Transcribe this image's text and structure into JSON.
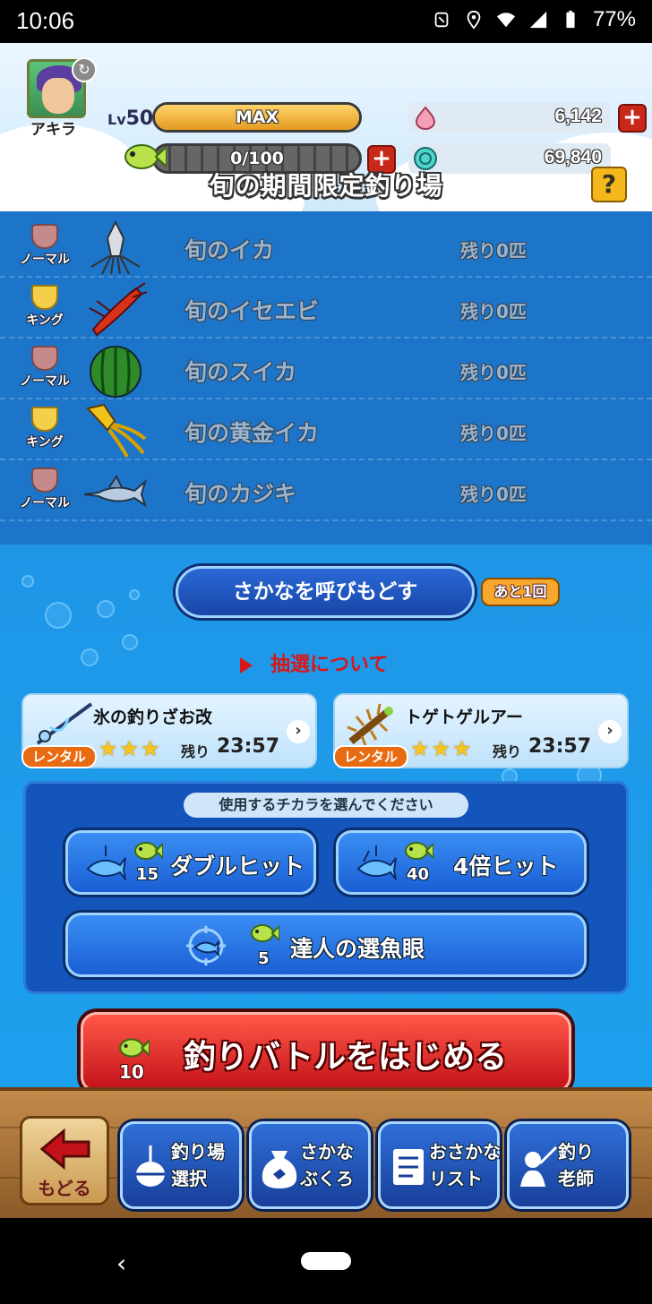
{
  "status_bar": {
    "time": "10:06",
    "battery": "77%"
  },
  "header": {
    "player_name": "アキラ",
    "level_prefix": "Lv",
    "level": "50",
    "exp_label": "MAX",
    "stamina": "0/100",
    "gems": "6,142",
    "coins": "69,840",
    "title": "旬の期間限定釣り場",
    "help": "?"
  },
  "fish": [
    {
      "rank": "ノーマル",
      "name": "旬のイカ",
      "remaining": "残り0匹"
    },
    {
      "rank": "キング",
      "name": "旬のイセエビ",
      "remaining": "残り0匹"
    },
    {
      "rank": "ノーマル",
      "name": "旬のスイカ",
      "remaining": "残り0匹"
    },
    {
      "rank": "キング",
      "name": "旬の黄金イカ",
      "remaining": "残り0匹"
    },
    {
      "rank": "ノーマル",
      "name": "旬のカジキ",
      "remaining": "残り0匹"
    }
  ],
  "recall": {
    "label": "さかなを呼びもどす",
    "remaining": "あと1回"
  },
  "lottery_link": "抽選について",
  "rentals": [
    {
      "name": "氷の釣りざお改",
      "tag": "レンタル",
      "stars": "★★★",
      "left_label": "残り",
      "time": "23:57"
    },
    {
      "name": "トゲトゲルアー",
      "tag": "レンタル",
      "stars": "★★★",
      "left_label": "残り",
      "time": "23:57"
    }
  ],
  "power": {
    "hint": "使用するチカラを選んでください",
    "double": {
      "label": "ダブルヒット",
      "cost": "15"
    },
    "quad": {
      "label": "4倍ヒット",
      "cost": "40"
    },
    "master": {
      "label": "達人の選魚眼",
      "cost": "5"
    }
  },
  "start": {
    "label": "釣りバトルをはじめる",
    "cost": "10"
  },
  "nav": {
    "back": "もどる",
    "spot": "釣り場\n選択",
    "bag": "さかな\nぶくろ",
    "list": "おさかな\nリスト",
    "teacher": "釣り\n老師"
  },
  "colors": {
    "accent_red": "#c4121a",
    "accent_blue": "#1a5fd4",
    "water": "#1c75c9"
  }
}
